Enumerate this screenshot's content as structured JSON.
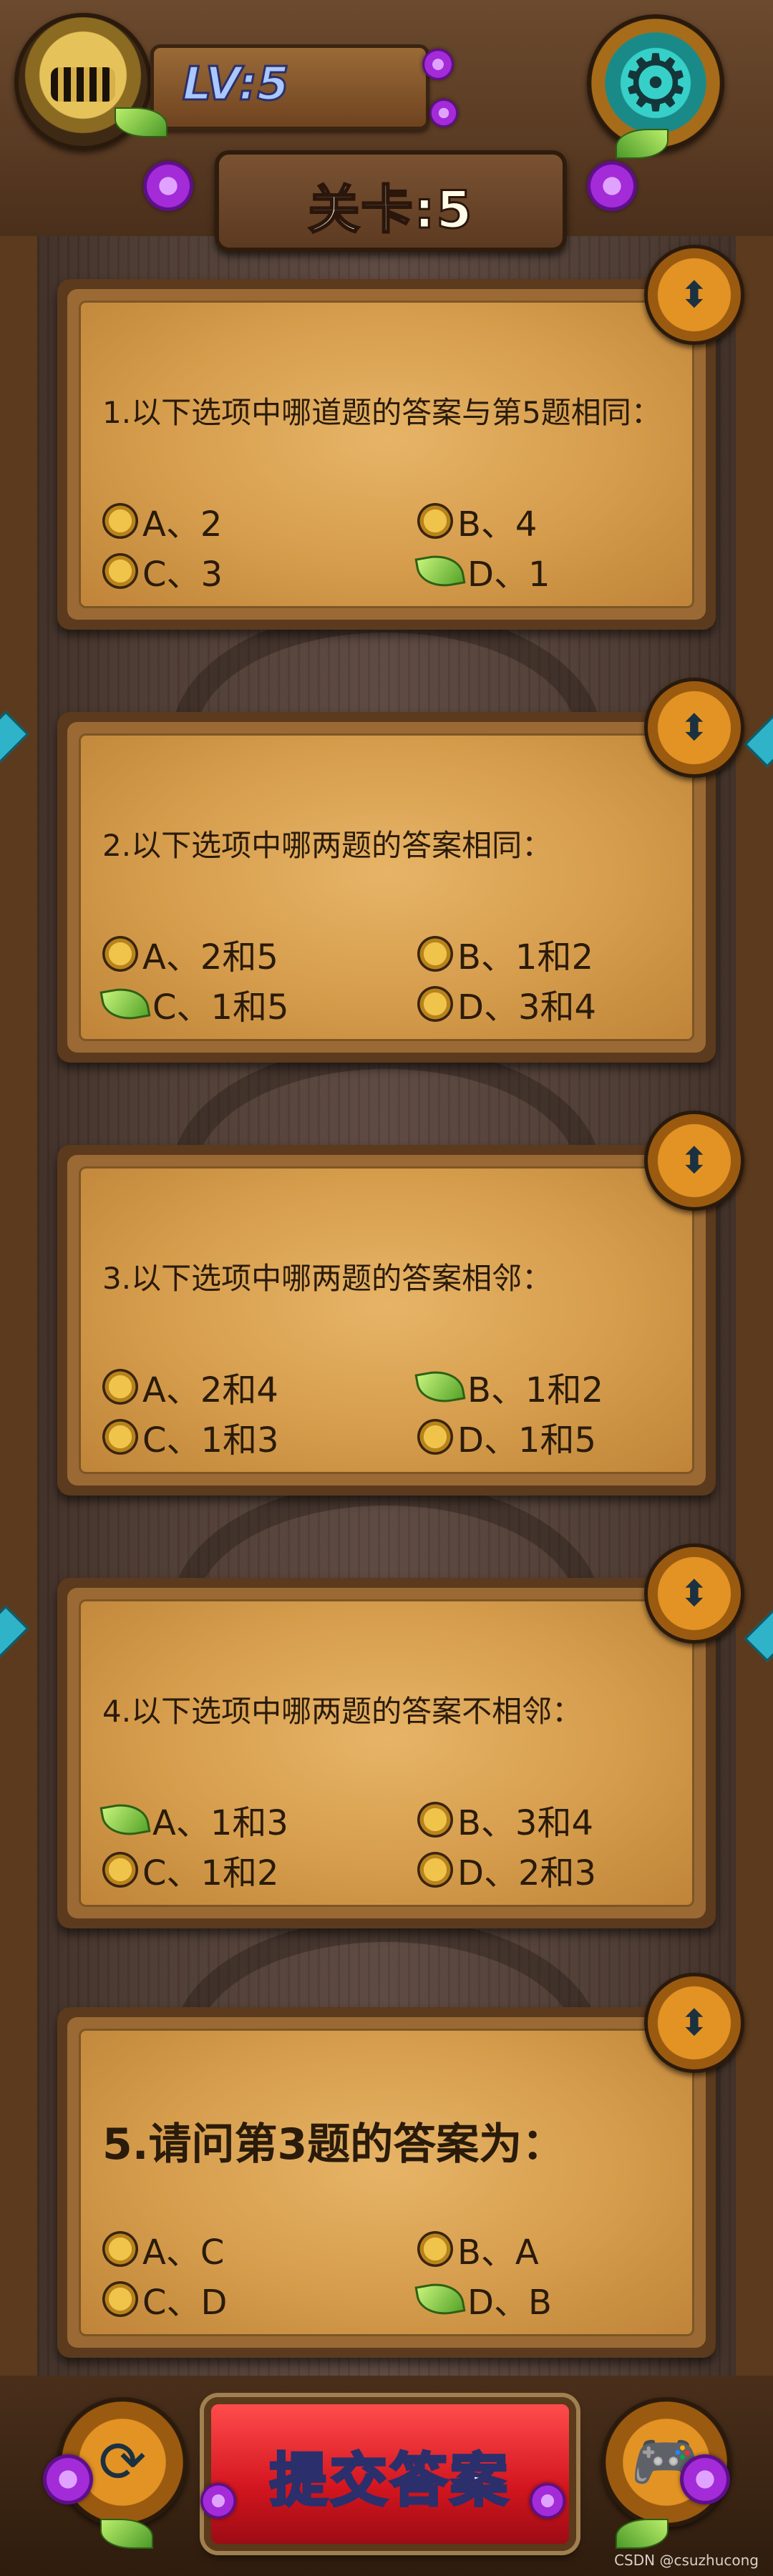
{
  "header": {
    "level": "LV:5",
    "stage": "关卡:5",
    "avatar_icon": "knight-helmet-icon",
    "settings_icon": "gear-icon"
  },
  "questions": [
    {
      "text": "1.以下选项中哪道题的答案与第5题相同：",
      "options": [
        {
          "label": "A、2",
          "selected": false
        },
        {
          "label": "B、4",
          "selected": false
        },
        {
          "label": "C、3",
          "selected": false
        },
        {
          "label": "D、1",
          "selected": true
        }
      ]
    },
    {
      "text": "2.以下选项中哪两题的答案相同：",
      "options": [
        {
          "label": "A、2和5",
          "selected": false
        },
        {
          "label": "B、1和2",
          "selected": false
        },
        {
          "label": "C、1和5",
          "selected": true
        },
        {
          "label": "D、3和4",
          "selected": false
        }
      ]
    },
    {
      "text": "3.以下选项中哪两题的答案相邻：",
      "options": [
        {
          "label": "A、2和4",
          "selected": false
        },
        {
          "label": "B、1和2",
          "selected": true
        },
        {
          "label": "C、1和3",
          "selected": false
        },
        {
          "label": "D、1和5",
          "selected": false
        }
      ]
    },
    {
      "text": "4.以下选项中哪两题的答案不相邻：",
      "options": [
        {
          "label": "A、1和3",
          "selected": true
        },
        {
          "label": "B、3和4",
          "selected": false
        },
        {
          "label": "C、1和2",
          "selected": false
        },
        {
          "label": "D、2和3",
          "selected": false
        }
      ]
    },
    {
      "text": "5.请问第3题的答案为：",
      "options": [
        {
          "label": "A、C",
          "selected": false
        },
        {
          "label": "B、A",
          "selected": false
        },
        {
          "label": "C、D",
          "selected": false
        },
        {
          "label": "D、B",
          "selected": true
        }
      ]
    }
  ],
  "footer": {
    "submit_label": "提交答案",
    "refresh_icon": "refresh-icon",
    "gamepad_icon": "gamepad-icon"
  },
  "watermark": "CSDN @csuzhucong"
}
